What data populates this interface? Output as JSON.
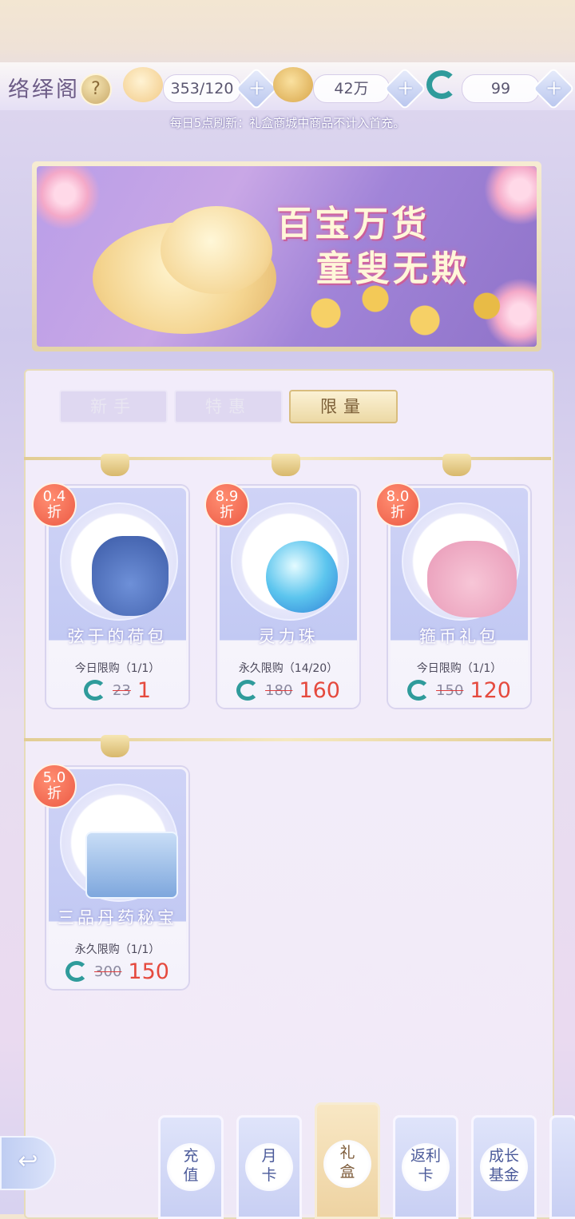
{
  "header": {
    "title": "络绎阁",
    "help_icon": "?",
    "stamina": "353/120",
    "coins": "42万",
    "jade": "99",
    "plus": "+"
  },
  "notice": "每日5点刷新：礼盒商城中商品不计入首充。",
  "banner": {
    "line1": "百宝万货",
    "line2": "童叟无欺"
  },
  "tabs": [
    {
      "label": "新手"
    },
    {
      "label": "特惠"
    },
    {
      "label": "限量"
    }
  ],
  "active_tab": "限量",
  "products": [
    {
      "discount": "0.4",
      "discount_unit": "折",
      "name": "弦于的荷包",
      "limit": "今日限购（1/1）",
      "old_price": "23",
      "price": "1"
    },
    {
      "discount": "8.9",
      "discount_unit": "折",
      "name": "灵力珠",
      "limit": "永久限购（14/20）",
      "old_price": "180",
      "price": "160"
    },
    {
      "discount": "8.0",
      "discount_unit": "折",
      "name": "箍币礼包",
      "limit": "今日限购（1/1）",
      "old_price": "150",
      "price": "120"
    },
    {
      "discount": "5.0",
      "discount_unit": "折",
      "name": "三品丹药秘宝",
      "limit": "永久限购（1/1）",
      "old_price": "300",
      "price": "150"
    }
  ],
  "bottom_nav": [
    {
      "line1": "充",
      "line2": "值"
    },
    {
      "line1": "月",
      "line2": "卡"
    },
    {
      "line1": "礼",
      "line2": "盒"
    },
    {
      "line1": "返利",
      "line2": "卡"
    },
    {
      "line1": "成长",
      "line2": "基金"
    }
  ],
  "back_icon": "↩",
  "colors": {
    "accent_red": "#e54a3e",
    "jade_green": "#2f9b9b",
    "gold": "#d9bd7e",
    "lavender": "#c2c9f3"
  }
}
